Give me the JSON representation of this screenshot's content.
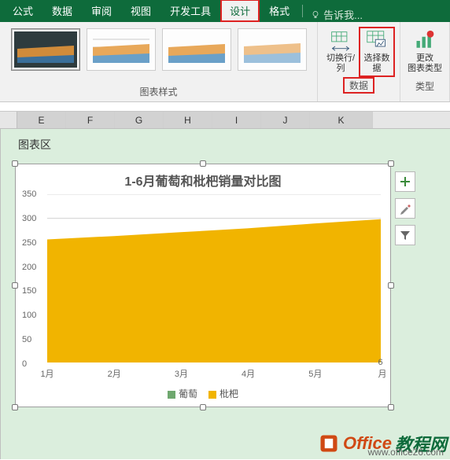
{
  "ribbon": {
    "tabs": [
      "公式",
      "数据",
      "审阅",
      "视图",
      "开发工具",
      "设计",
      "格式"
    ],
    "active_tab": "设计",
    "highlighted_tab": "设计",
    "tell_me": "告诉我...",
    "groups": {
      "styles": {
        "label": "图表样式"
      },
      "data": {
        "label": "数据",
        "switch_rowcol": "切换行/列",
        "select_data": "选择数据"
      },
      "type": {
        "label": "类型",
        "change_type": "更改\n图表类型"
      }
    }
  },
  "columns": [
    "E",
    "F",
    "G",
    "H",
    "I",
    "J",
    "K"
  ],
  "chart_area_label": "图表区",
  "side_buttons": [
    "plus",
    "brush",
    "filter"
  ],
  "chart_data": {
    "type": "area",
    "title": "1-6月葡萄和枇杷销量对比图",
    "categories": [
      "1月",
      "2月",
      "3月",
      "4月",
      "5月",
      "6月"
    ],
    "series": [
      {
        "name": "葡萄",
        "color": "#6fa86f",
        "values": [
          0,
          0,
          0,
          0,
          0,
          0
        ]
      },
      {
        "name": "枇杷",
        "color": "#f1b400",
        "values": [
          256,
          263,
          271,
          279,
          289,
          298
        ]
      }
    ],
    "ylim": [
      0,
      350
    ],
    "yticks": [
      0,
      50,
      100,
      150,
      200,
      250,
      300,
      350
    ],
    "xlabel": "",
    "ylabel": ""
  },
  "watermark": {
    "brand1": "Office",
    "brand2": "教程网",
    "url": "www.office26.com"
  }
}
